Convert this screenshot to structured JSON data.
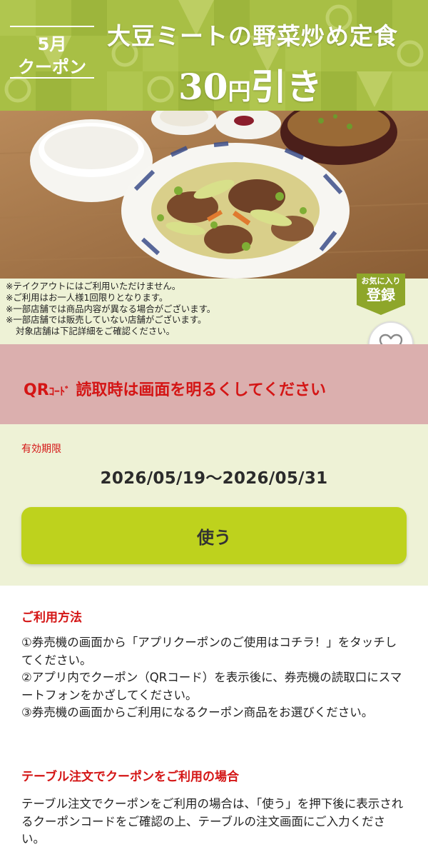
{
  "banner": {
    "month": "5月",
    "coupon_word": "クーポン",
    "dish_title": "大豆ミートの野菜炒め定食",
    "discount_amount": "30",
    "discount_unit": "円",
    "discount_suffix": "引き",
    "background_color": "#a8bf45"
  },
  "notes": [
    "※テイクアウトにはご利用いただけません。",
    "※ご利用はお一人様1回限りとなります。",
    "※一部店舗では商品内容が異なる場合がございます。",
    "※一部店舗では販売していない店舗がございます。",
    "対象店舗は下記詳細をご確認ください。"
  ],
  "favorite_badge": {
    "top": "お気に入り",
    "main": "登録",
    "color": "#8ea62a"
  },
  "favorite_button": {
    "icon": "heart-outline-icon"
  },
  "qr_warning": {
    "qr": "QR",
    "code_word": "ｺｰﾄﾞ",
    "message": " 読取時は画面を明るくしてください",
    "color": "#d41515",
    "background": "#dbafae"
  },
  "validity": {
    "label": "有効期限",
    "dates": "2026/05/19〜2026/05/31"
  },
  "use_button": {
    "label": "使う",
    "color": "#bed21d"
  },
  "how_to": {
    "heading": "ご利用方法",
    "steps": [
      "①券売機の画面から「アプリクーポンのご使用はコチラ！」をタッチしてください。",
      "②アプリ内でクーポン（QRコード）を表示後に、券売機の読取口にスマートフォンをかざしてください。",
      "③券売機の画面からご利用になるクーポン商品をお選びください。"
    ]
  },
  "table_order": {
    "heading": "テーブル注文でクーポンをご利用の場合",
    "text": "テーブル注文でクーポンをご利用の場合は、「使う」を押下後に表示されるクーポンコードをご確認の上、テーブルの注文画面にご入力ください。"
  }
}
